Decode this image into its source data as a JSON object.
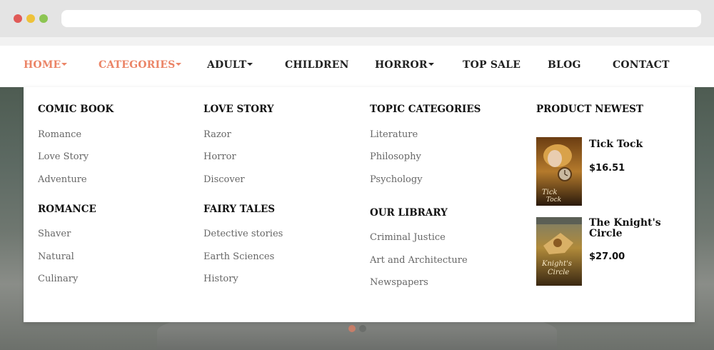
{
  "nav": {
    "items": [
      {
        "label": "HOME",
        "has_caret": true,
        "active": true
      },
      {
        "label": "CATEGORIES",
        "has_caret": true,
        "active": true
      },
      {
        "label": "ADULT",
        "has_caret": true,
        "active": false
      },
      {
        "label": "CHILDREN",
        "has_caret": false,
        "active": false
      },
      {
        "label": "HORROR",
        "has_caret": true,
        "active": false
      },
      {
        "label": "TOP SALE",
        "has_caret": false,
        "active": false
      },
      {
        "label": "BLOG",
        "has_caret": false,
        "active": false
      },
      {
        "label": "CONTACT",
        "has_caret": false,
        "active": false
      }
    ],
    "accent_color": "#eb8466"
  },
  "mega_menu": {
    "columns": [
      {
        "groups": [
          {
            "title": "COMIC BOOK",
            "links": [
              "Romance",
              "Love Story",
              "Adventure"
            ]
          },
          {
            "title": "ROMANCE",
            "links": [
              "Shaver",
              "Natural",
              "Culinary"
            ]
          }
        ]
      },
      {
        "groups": [
          {
            "title": "LOVE STORY",
            "links": [
              "Razor",
              "Horror",
              "Discover"
            ]
          },
          {
            "title": "FAIRY TALES",
            "links": [
              "Detective stories",
              "Earth Sciences",
              "History"
            ]
          }
        ]
      },
      {
        "groups": [
          {
            "title": "TOPIC CATEGORIES",
            "links": [
              "Literature",
              "Philosophy",
              "Psychology"
            ]
          },
          {
            "title": "OUR LIBRARY",
            "links": [
              "Criminal Justice",
              "Art and Architecture",
              "Newspapers"
            ]
          }
        ]
      }
    ],
    "products": {
      "title": "PRODUCT NEWEST",
      "items": [
        {
          "name": "Tick Tock",
          "price": "$16.51"
        },
        {
          "name": "The Knight's Circle",
          "price": "$27.00"
        }
      ]
    }
  }
}
